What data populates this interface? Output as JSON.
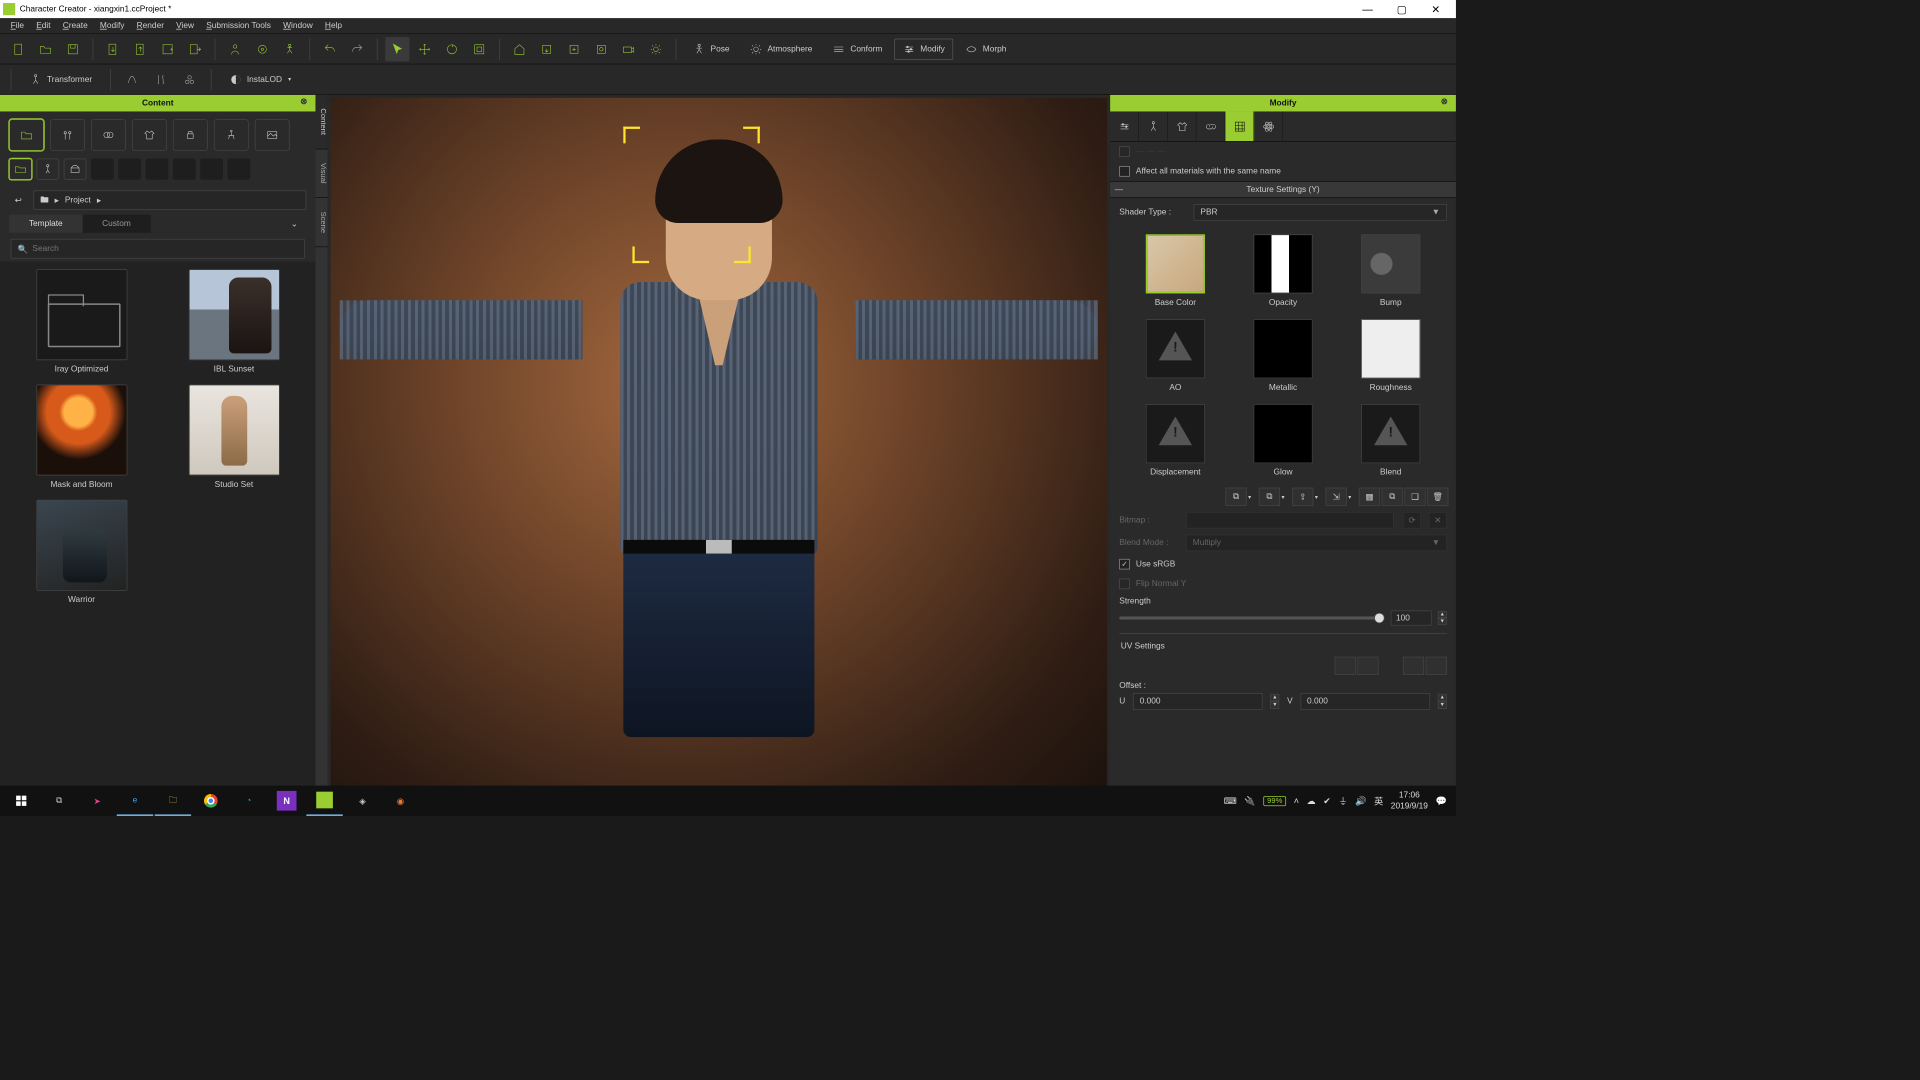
{
  "title": "Character Creator - xiangxin1.ccProject *",
  "menu": [
    "File",
    "Edit",
    "Create",
    "Modify",
    "Render",
    "View",
    "Submission Tools",
    "Window",
    "Help"
  ],
  "modes": {
    "pose": "Pose",
    "atmosphere": "Atmosphere",
    "conform": "Conform",
    "modify": "Modify",
    "morph": "Morph"
  },
  "tool2": {
    "transformer": "Transformer",
    "instalod": "InstaLOD"
  },
  "left": {
    "header": "Content",
    "sideTabs": [
      "Content",
      "Visual",
      "Scene"
    ],
    "path": "Project",
    "subtabs": {
      "template": "Template",
      "custom": "Custom"
    },
    "searchPlaceholder": "Search",
    "items": [
      {
        "label": "Iray Optimized",
        "type": "folder"
      },
      {
        "label": "IBL Sunset",
        "type": "scene1"
      },
      {
        "label": "Mask and Bloom",
        "type": "scene2"
      },
      {
        "label": "Studio Set",
        "type": "scene3"
      },
      {
        "label": "Warrior",
        "type": "scene4"
      }
    ]
  },
  "right": {
    "header": "Modify",
    "affect": "Affect all materials with the same name",
    "textureSettings": "Texture Settings  (Y)",
    "shaderType": "Shader Type :",
    "shaderVal": "PBR",
    "tex": [
      "Base Color",
      "Opacity",
      "Bump",
      "AO",
      "Metallic",
      "Roughness",
      "Displacement",
      "Glow",
      "Blend"
    ],
    "bitmap": "Bitmap :",
    "blendMode": "Blend Mode :",
    "blendVal": "Multiply",
    "srgb": "Use sRGB",
    "flip": "Flip Normal Y",
    "strength": "Strength",
    "strengthVal": "100",
    "uv": "UV Settings",
    "offset": "Offset :",
    "u": "U",
    "uval": "0.000",
    "v": "V",
    "vval": "0.000"
  },
  "tray": {
    "battery": "99%",
    "time": "17:06",
    "date": "2019/9/19"
  }
}
